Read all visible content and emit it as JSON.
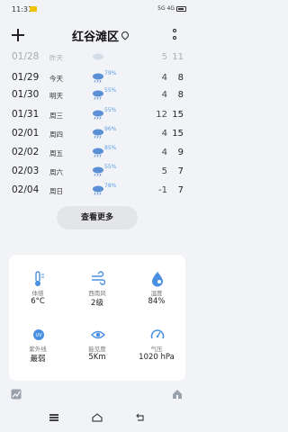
{
  "status_bar": {
    "time": "11:31",
    "right_text": "5G 4G",
    "battery": "24"
  },
  "header": {
    "city": "红谷滩区"
  },
  "forecast": [
    {
      "date": "01/28",
      "day": "昨天",
      "pop": "",
      "low": "5",
      "high": "11",
      "faded": true
    },
    {
      "date": "01/29",
      "day": "今天",
      "pop": "79%",
      "low": "4",
      "high": "8"
    },
    {
      "date": "01/30",
      "day": "明天",
      "pop": "55%",
      "low": "4",
      "high": "8"
    },
    {
      "date": "01/31",
      "day": "周三",
      "pop": "55%",
      "low": "12",
      "high": "15"
    },
    {
      "date": "02/01",
      "day": "周四",
      "pop": "96%",
      "low": "4",
      "high": "15"
    },
    {
      "date": "02/02",
      "day": "周五",
      "pop": "85%",
      "low": "4",
      "high": "9"
    },
    {
      "date": "02/03",
      "day": "周六",
      "pop": "55%",
      "low": "5",
      "high": "7"
    },
    {
      "date": "02/04",
      "day": "周日",
      "pop": "78%",
      "low": "-1",
      "high": "7"
    }
  ],
  "more_button": {
    "label": "查看更多"
  },
  "details": [
    {
      "icon": "thermometer-icon",
      "label": "体感",
      "value": "6°C"
    },
    {
      "icon": "wind-icon",
      "label": "西南风",
      "value": "2级"
    },
    {
      "icon": "humidity-icon",
      "label": "湿度",
      "value": "84%"
    },
    {
      "icon": "uv-icon",
      "label": "紫外线",
      "value": "最弱"
    },
    {
      "icon": "visibility-icon",
      "label": "能见度",
      "value": "5Km"
    },
    {
      "icon": "pressure-icon",
      "label": "气压",
      "value": "1020 hPa"
    }
  ],
  "colors": {
    "accent": "#4a90e2",
    "background": "#f1f3f6",
    "card": "#ffffff"
  }
}
